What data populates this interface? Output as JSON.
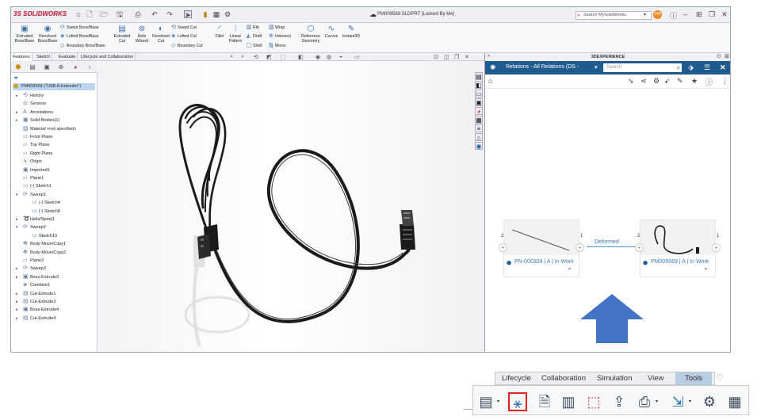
{
  "app": {
    "brand_prefix": "3S",
    "brand_name": "SOLIDWORKS",
    "doc_title": "PM009569.SLDPRT [Locked By Me]",
    "search_placeholder": "Search MySolidWorks",
    "user_initials": "PM"
  },
  "command_manager": {
    "extruded_boss": "Extruded\nBoss/Base",
    "revolved_boss": "Revolved\nBoss/Base",
    "swept_boss": "Swept Boss/Base",
    "lofted_boss": "Lofted Boss/Base",
    "boundary_boss": "Boundary Boss/Base",
    "extruded_cut": "Extruded\nCut",
    "hole_wizard": "Hole\nWizard",
    "revolved_cut": "Revolved\nCut",
    "swept_cut": "Swept Cut",
    "lofted_cut": "Lofted Cut",
    "boundary_cut": "Boundary Cut",
    "fillet": "Fillet",
    "linear_pattern": "Linear\nPattern",
    "rib": "Rib",
    "draft": "Draft",
    "shell": "Shell",
    "wrap": "Wrap",
    "intersect": "Intersect",
    "mirror": "Mirror",
    "reference_geometry": "Reference\nGeometry",
    "curves": "Curves",
    "instant3d": "Instant3D"
  },
  "cm_tabs": [
    "Features",
    "Sketch",
    "Evaluate",
    "Lifecycle and Collaboration"
  ],
  "tree": {
    "root": "PM009569 (\"USB A Extender\")",
    "items": [
      {
        "label": "History",
        "icon": "history-icon",
        "expand": "▸",
        "indent": 0
      },
      {
        "label": "Sensors",
        "icon": "sensor-icon",
        "expand": "",
        "indent": 0
      },
      {
        "label": "Annotations",
        "icon": "annotation-icon",
        "expand": "▸",
        "indent": 0
      },
      {
        "label": "Solid Bodies(1)",
        "icon": "solid-bodies-icon",
        "expand": "▸",
        "indent": 0
      },
      {
        "label": "Material <not specified>",
        "icon": "material-icon",
        "expand": "",
        "indent": 0
      },
      {
        "label": "Front Plane",
        "icon": "plane-icon",
        "expand": "",
        "indent": 0
      },
      {
        "label": "Top Plane",
        "icon": "plane-icon",
        "expand": "",
        "indent": 0
      },
      {
        "label": "Right Plane",
        "icon": "plane-icon",
        "expand": "",
        "indent": 0
      },
      {
        "label": "Origin",
        "icon": "origin-icon",
        "expand": "",
        "indent": 0
      },
      {
        "label": "Imported1",
        "icon": "imported-icon",
        "expand": "",
        "indent": 0
      },
      {
        "label": "Plane1",
        "icon": "plane-icon",
        "expand": "",
        "indent": 0
      },
      {
        "label": "(-) Sketch1",
        "icon": "sketch-icon",
        "expand": "",
        "indent": 0
      },
      {
        "label": "Sweep1",
        "icon": "sweep-icon",
        "expand": "▾",
        "indent": 0
      },
      {
        "label": "(-) Sketch4",
        "icon": "sketch-icon",
        "expand": "",
        "indent": 1
      },
      {
        "label": "(-) Sketch8",
        "icon": "sketch-icon",
        "expand": "",
        "indent": 1
      },
      {
        "label": "Helix/Spiral1",
        "icon": "helix-icon",
        "expand": "▸",
        "indent": 0
      },
      {
        "label": "Sweep2",
        "icon": "sweep-icon",
        "expand": "▾",
        "indent": 0
      },
      {
        "label": "Sketch10",
        "icon": "sketch-icon",
        "expand": "",
        "indent": 1
      },
      {
        "label": "Body-Move/Copy1",
        "icon": "move-copy-icon",
        "expand": "",
        "indent": 0
      },
      {
        "label": "Body-Move/Copy2",
        "icon": "move-copy-icon",
        "expand": "",
        "indent": 0
      },
      {
        "label": "Plane2",
        "icon": "plane-icon",
        "expand": "",
        "indent": 0
      },
      {
        "label": "Sweep3",
        "icon": "sweep-icon",
        "expand": "▸",
        "indent": 0
      },
      {
        "label": "Boss-Extrude3",
        "icon": "extrude-icon",
        "expand": "▸",
        "indent": 0
      },
      {
        "label": "Combine1",
        "icon": "combine-icon",
        "expand": "",
        "indent": 0
      },
      {
        "label": "Cut-Extrude1",
        "icon": "cut-extrude-icon",
        "expand": "▸",
        "indent": 0
      },
      {
        "label": "Cut-Extrude3",
        "icon": "cut-extrude-icon",
        "expand": "▸",
        "indent": 0
      },
      {
        "label": "Boss-Extrude4",
        "icon": "extrude-icon",
        "expand": "▸",
        "indent": 0
      },
      {
        "label": "Cut-Extrude4",
        "icon": "cut-extrude-icon",
        "expand": "▸",
        "indent": 0
      }
    ]
  },
  "pane": {
    "top_label": "3DEXPERIENCE",
    "title": "Relations - All Relations (DS -",
    "search_placeholder": "Search",
    "left_node": {
      "label": "PN-000309 | A | In Work",
      "count_left": "2",
      "count_right": "1"
    },
    "right_node": {
      "label": "PM009569 | A | In Work",
      "count_left": "2",
      "count_right": "1"
    },
    "edge_label": "Deformed"
  },
  "bottom_tabs": [
    "Lifecycle",
    "Collaboration",
    "Simulation",
    "View",
    "Tools"
  ],
  "active_bottom_tab": "Tools",
  "colors": {
    "accent": "#1f5b8e",
    "highlight": "#e0201c",
    "arrow": "#4472c4",
    "active_tab": "#b8cce4"
  }
}
